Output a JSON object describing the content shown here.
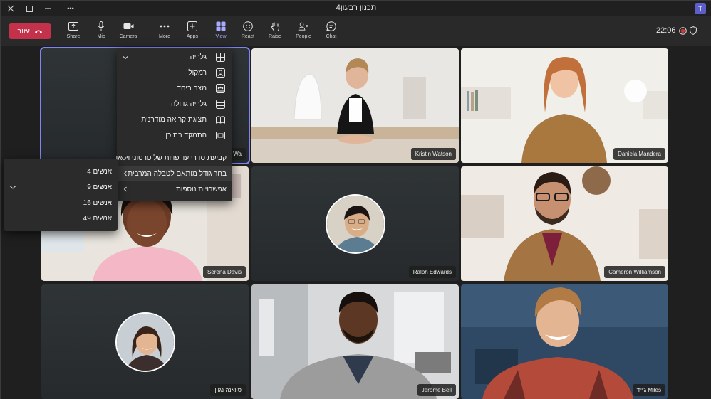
{
  "window": {
    "title": "תכנון רבעון4"
  },
  "titlebar": {
    "more_label": "•••"
  },
  "toolbar": {
    "timer": "22:06",
    "leave_label": "עזוב",
    "tools": {
      "chat": "Chat",
      "people": "People",
      "raise": "Raise",
      "react": "React",
      "view": "View",
      "apps": "Apps",
      "more": "More",
      "camera": "Camera",
      "mic": "Mic",
      "share": "Share"
    },
    "people_count": "9"
  },
  "participants": [
    {
      "name": "Wa"
    },
    {
      "name": "Kristin Watson"
    },
    {
      "name": "Daniela Mandera"
    },
    {
      "name": "Serena Davis"
    },
    {
      "name": "Ralph Edwards"
    },
    {
      "name": "Cameron Williamson"
    },
    {
      "name": "סוואנה נגוין"
    },
    {
      "name": "Jerome Bell"
    },
    {
      "name": "ג'ייד Miles"
    }
  ],
  "view_menu": {
    "items": [
      {
        "label": "גלריה"
      },
      {
        "label": "רמקול"
      },
      {
        "label": "מצב ביחד"
      },
      {
        "label": "גלריה גדולה"
      },
      {
        "label": "תצוגת קריאה מודרנית"
      },
      {
        "label": "התמקד בתוכן"
      },
      {
        "label": "קביעת סדרי עדיפויות של סרטוני וידאו"
      },
      {
        "label": "בחר גודל מותאם לטבלה המרבית"
      },
      {
        "label": "אפשרויות נוספות"
      }
    ]
  },
  "grid_submenu": {
    "items": [
      {
        "label": "4 אנשים"
      },
      {
        "label": "9 אנשים"
      },
      {
        "label": "16 אנשים"
      },
      {
        "label": "49 אנשים"
      }
    ]
  },
  "colors": {
    "accent": "#7f85f5",
    "leave": "#c4314b",
    "toolbar": "#292929",
    "menu": "#2b2b2b"
  }
}
